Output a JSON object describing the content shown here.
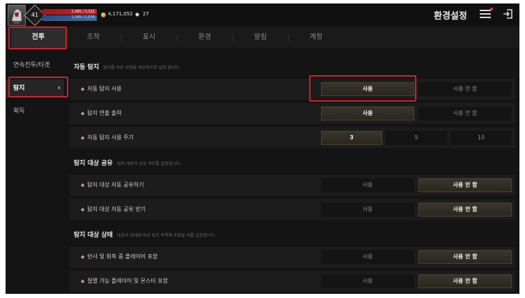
{
  "header": {
    "level": "41",
    "hp_text": "2,985 / 3,315",
    "mp_text": "1,265 / 1,575",
    "gold_icon": "coin-icon",
    "gold": "4,171,052",
    "gem_icon": "gem-icon",
    "gems": "27",
    "settings_title": "환경설정",
    "menu_icon": "menu-icon",
    "exit_icon": "exit-icon"
  },
  "tabs": [
    {
      "label": "전투",
      "active": true
    },
    {
      "label": "조작"
    },
    {
      "label": "표시"
    },
    {
      "label": "환경"
    },
    {
      "label": "알림"
    },
    {
      "label": "계정"
    }
  ],
  "sidebar": {
    "items": [
      {
        "label": "연속전투/타겟"
      },
      {
        "label": "탐지",
        "active": true
      },
      {
        "label": "획득"
      }
    ]
  },
  "sections": {
    "auto_detect": {
      "title": "자동 탐지",
      "desc": "탐지를 자동 사용을 세부적으로 설정 합니다.",
      "rows": [
        {
          "label": "자동 탐지 사용",
          "options": [
            "사용",
            "사용 안 함"
          ],
          "selected": 0
        },
        {
          "label": "탐지 연출 출력",
          "options": [
            "사용",
            "사용 안 함"
          ],
          "selected": 0
        },
        {
          "label": "자동 탐지 사용 주기",
          "options": [
            "3",
            "5",
            "10"
          ],
          "selected": 0
        }
      ]
    },
    "share": {
      "title": "탐지 대상 공유",
      "desc": "탐지 대상의 공유 여부를 설정합니다.",
      "rows": [
        {
          "label": "탐지 대상 자동 공유하기",
          "options": [
            "사용",
            "사용 안 함"
          ],
          "selected": 1
        },
        {
          "label": "탐지 대상 자동 공유 받기",
          "options": [
            "사용",
            "사용 안 함"
          ],
          "selected": 1
        }
      ]
    },
    "status": {
      "title": "탐지 대상 상태",
      "desc": "대상의 상태에 따라 탐지 목록에 포함될 지를 설정합니다.",
      "rows": [
        {
          "label": "빈사 및 회복 중 플레이어 포함",
          "options": [
            "사용",
            "사용 안 함"
          ],
          "selected": 1
        },
        {
          "label": "절멸 가능 플레이어 및 몬스터 포함",
          "options": [
            "사용",
            "사용 안 함"
          ],
          "selected": 1
        }
      ]
    }
  },
  "colors": {
    "highlight": "#d2202b",
    "selected_bg": "#3a352c",
    "background": "#141414"
  }
}
